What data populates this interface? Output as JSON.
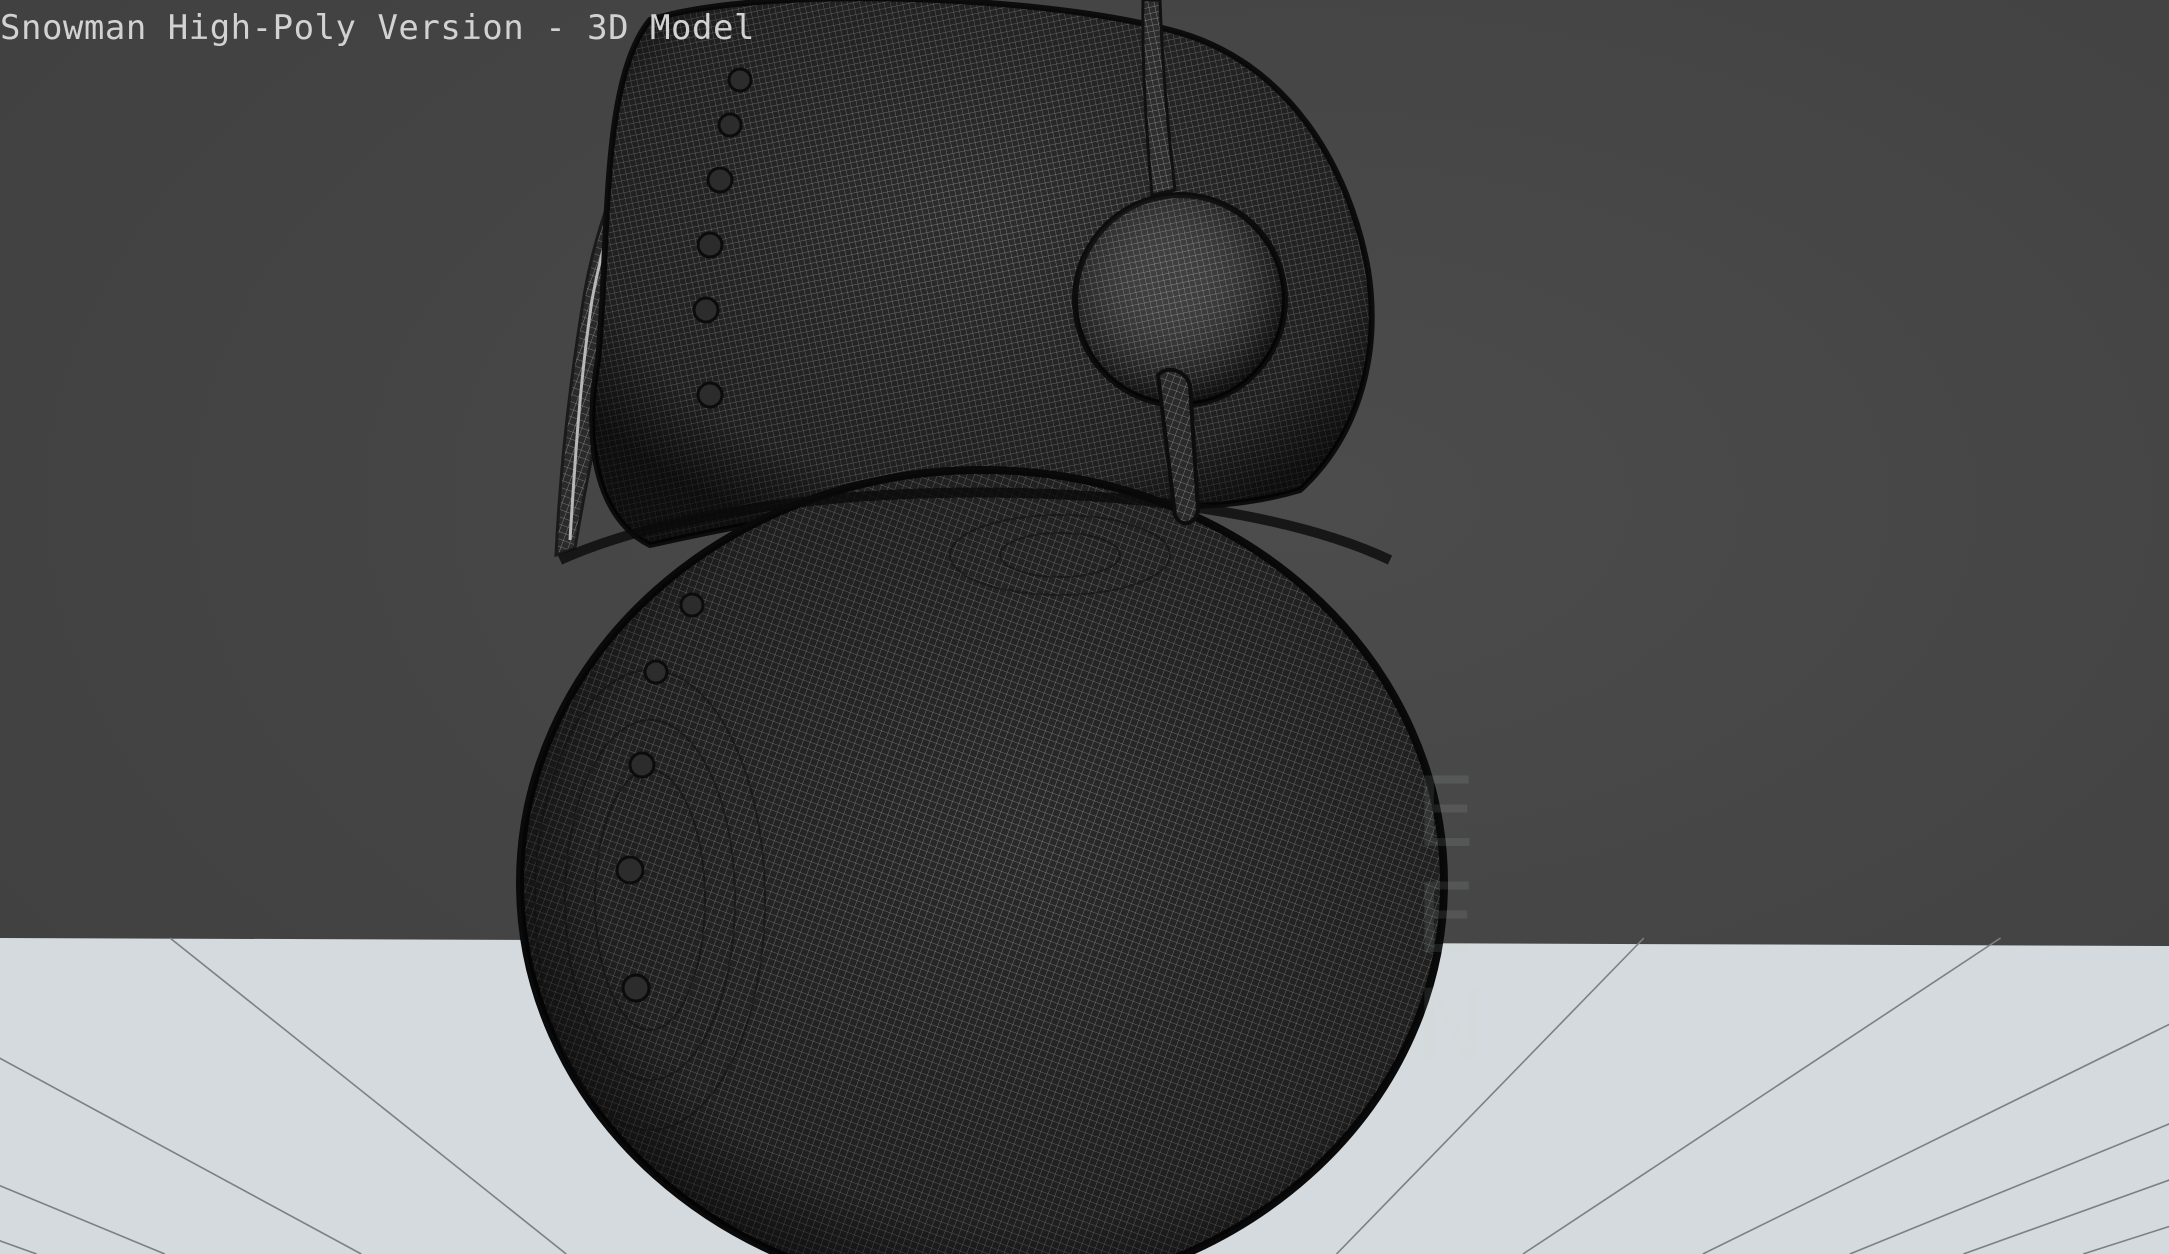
{
  "viewport": {
    "title": "Snowman High-Poly Version - 3D Model",
    "watermark_glyphs": "E\nE\nN",
    "display_mode": "wireframe",
    "colors": {
      "background": "#474747",
      "ground_plane": "#d4dadd",
      "wire_dark": "#111111",
      "wire_light": "#9a9a9a",
      "title_text": "#d2d2d2"
    }
  },
  "scene": {
    "object": "snowman-mesh",
    "parts": [
      "lower-body-sphere",
      "upper-body-sphere",
      "scarf",
      "arm-ball",
      "stick-arm",
      "coal-buttons",
      "ground-plane"
    ]
  }
}
